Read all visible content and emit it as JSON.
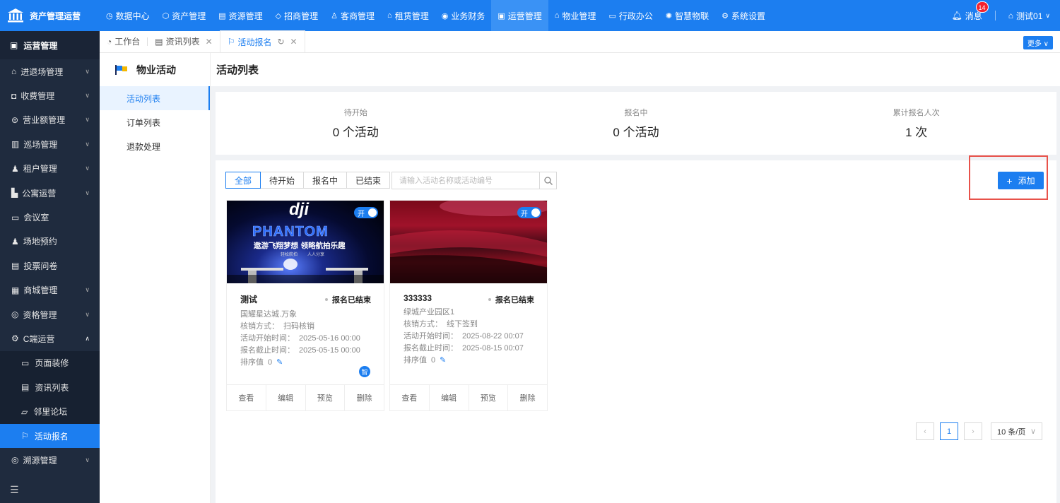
{
  "colors": {
    "primary": "#1c7ef0",
    "sidebar_bg": "#1f2b3e",
    "highlight_border": "#e8524a"
  },
  "brand": {
    "title": "资产管理运营",
    "icon": "bank-icon"
  },
  "topnav": [
    {
      "label": "数据中心",
      "icon": "clock-icon"
    },
    {
      "label": "资产管理",
      "icon": "cube-icon"
    },
    {
      "label": "资源管理",
      "icon": "building-icon"
    },
    {
      "label": "招商管理",
      "icon": "tag-icon"
    },
    {
      "label": "客商管理",
      "icon": "users-icon"
    },
    {
      "label": "租赁管理",
      "icon": "home-icon"
    },
    {
      "label": "业务财务",
      "icon": "coin-icon"
    },
    {
      "label": "运营管理",
      "icon": "operations-icon",
      "active": true
    },
    {
      "label": "物业管理",
      "icon": "house-icon"
    },
    {
      "label": "行政办公",
      "icon": "monitor-icon"
    },
    {
      "label": "智慧物联",
      "icon": "iot-icon"
    },
    {
      "label": "系统设置",
      "icon": "gear-icon"
    }
  ],
  "topright": {
    "messages_label": "消息",
    "messages_count": "14",
    "user": "测试01"
  },
  "sidebar": {
    "header": "运营管理",
    "items": [
      {
        "label": "进退场管理",
        "icon": "enter-exit-icon",
        "chevron": "down"
      },
      {
        "label": "收费管理",
        "icon": "wallet-icon",
        "chevron": "down"
      },
      {
        "label": "营业额管理",
        "icon": "dollar-icon",
        "chevron": "down"
      },
      {
        "label": "巡场管理",
        "icon": "map-icon",
        "chevron": "down"
      },
      {
        "label": "租户管理",
        "icon": "user-icon",
        "chevron": "down"
      },
      {
        "label": "公寓运营",
        "icon": "apartment-icon",
        "chevron": "down"
      },
      {
        "label": "会议室",
        "icon": "meeting-icon"
      },
      {
        "label": "场地预约",
        "icon": "person-icon"
      },
      {
        "label": "投票问卷",
        "icon": "survey-icon"
      },
      {
        "label": "商城管理",
        "icon": "shop-icon",
        "chevron": "down"
      },
      {
        "label": "资格管理",
        "icon": "qualification-icon",
        "chevron": "down"
      },
      {
        "label": "C端运营",
        "icon": "c-ops-icon",
        "chevron": "up"
      }
    ],
    "subitems": [
      {
        "label": "页面装修",
        "icon": "page-icon"
      },
      {
        "label": "资讯列表",
        "icon": "news-icon"
      },
      {
        "label": "邻里论坛",
        "icon": "forum-icon"
      },
      {
        "label": "活动报名",
        "icon": "flag-icon",
        "active": true
      }
    ],
    "last_item": {
      "label": "溯源管理",
      "icon": "trace-icon",
      "chevron": "down"
    }
  },
  "tabs": [
    {
      "label": "工作台",
      "icon": "dashboard-icon"
    },
    {
      "label": "资讯列表",
      "icon": "news-icon",
      "closable": true
    },
    {
      "label": "活动报名",
      "icon": "flag-icon",
      "closable": true,
      "active": true
    }
  ],
  "more_label": "更多",
  "subcol": {
    "title": "物业活动",
    "items": [
      {
        "label": "活动列表",
        "active": true
      },
      {
        "label": "订单列表"
      },
      {
        "label": "退款处理"
      }
    ]
  },
  "page_title": "活动列表",
  "stats": [
    {
      "label": "待开始",
      "value": "0 个活动"
    },
    {
      "label": "报名中",
      "value": "0 个活动"
    },
    {
      "label": "累计报名人次",
      "value": "1 次"
    }
  ],
  "filters": [
    "全部",
    "待开始",
    "报名中",
    "已结束"
  ],
  "search": {
    "placeholder": "请输入活动名称或活动编号"
  },
  "add_label": "添加",
  "toggle_label": "开",
  "field_labels": {
    "verify": "核销方式：",
    "start": "活动开始时间：",
    "deadline": "报名截止时间：",
    "sort": "排序值"
  },
  "cards": [
    {
      "title": "测试",
      "status": "报名已结束",
      "location": "国耀星达城.万象",
      "verify": "扫码核销",
      "start": "2025-05-16 00:00",
      "deadline": "2025-05-15 00:00",
      "sort": "0",
      "badge": "智",
      "image_text": {
        "brand": "dji",
        "product": "PHANTOM",
        "slogan": "遨游飞翔梦想  领略航拍乐趣",
        "sub1": "轻松航拍",
        "sub2": "人人分享"
      }
    },
    {
      "title": "333333",
      "status": "报名已结束",
      "location": "绿城产业园区1",
      "verify": "线下签到",
      "start": "2025-08-22 00:07",
      "deadline": "2025-08-15 00:07",
      "sort": "0"
    }
  ],
  "card_actions": [
    "查看",
    "编辑",
    "预览",
    "删除"
  ],
  "pagination": {
    "current": "1",
    "page_size": "10 条/页"
  }
}
